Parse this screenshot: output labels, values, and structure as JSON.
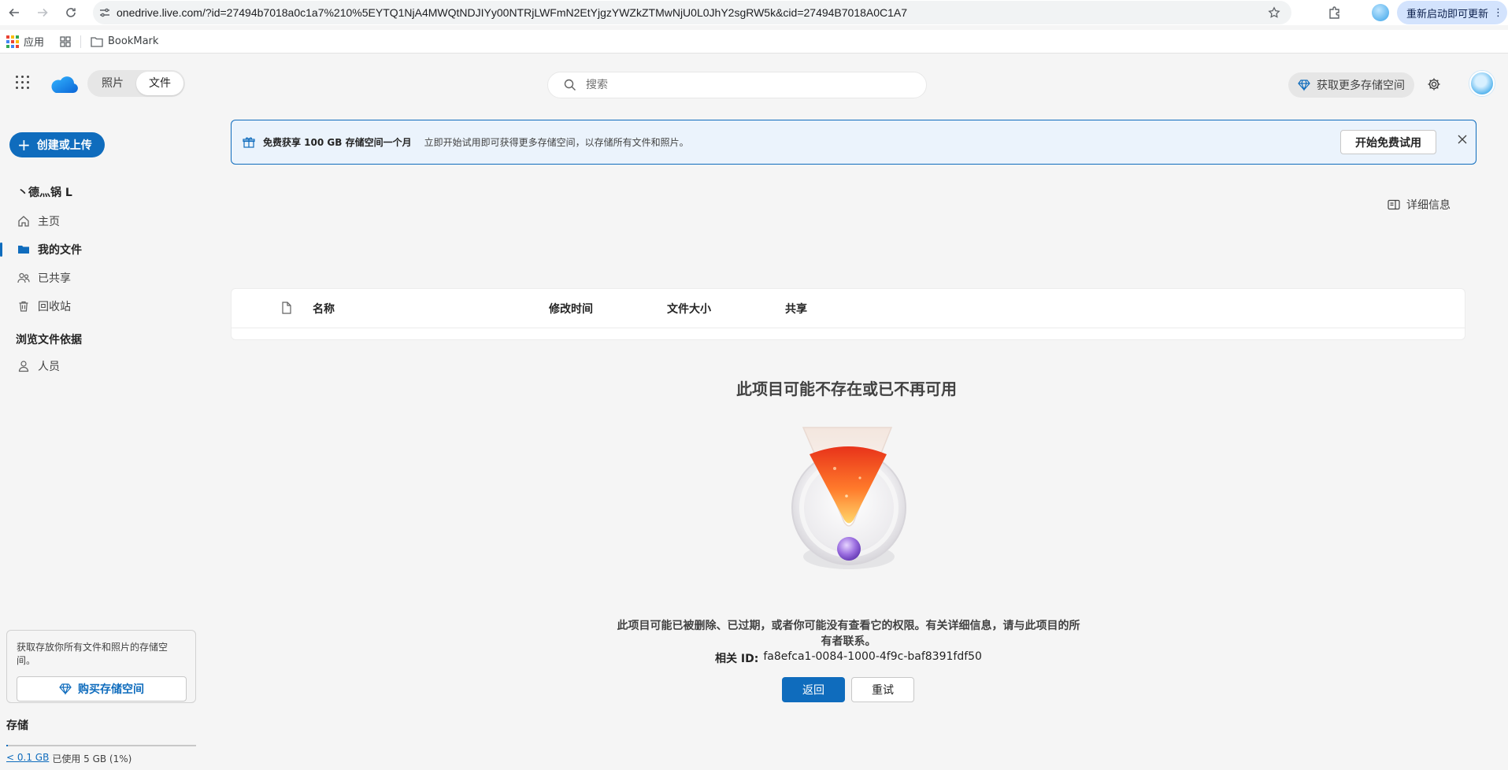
{
  "browser": {
    "url": "onedrive.live.com/?id=27494b7018a0c1a7%210%5EYTQ1NjA4MWQtNDJIYy00NTRjLWFmN2EtYjgzYWZkZTMwNjU0L0JhY2sgRW5k&cid=27494B7018A0C1A7",
    "update_label": "重新启动即可更新",
    "bookmarks": {
      "apps_label": "应用",
      "folder_label": "BookMark"
    }
  },
  "header": {
    "tabs": [
      {
        "label": "照片"
      },
      {
        "label": "文件"
      }
    ],
    "search": {
      "placeholder": "搜索",
      "value": ""
    },
    "get_storage_label": "获取更多存储空间"
  },
  "sidebar": {
    "create_label": "创建或上传",
    "account_name": "丶德灬锅 L",
    "items": [
      {
        "label": "主页",
        "icon": "home-icon"
      },
      {
        "label": "我的文件",
        "icon": "folder-icon"
      },
      {
        "label": "已共享",
        "icon": "people-icon"
      },
      {
        "label": "回收站",
        "icon": "trash-icon"
      }
    ],
    "browse_heading": "浏览文件依据",
    "browse_items": [
      {
        "label": "人员",
        "icon": "person-icon"
      }
    ],
    "promo": {
      "text": "获取存放你所有文件和照片的存储空间。",
      "button_label": "购买存储空间"
    },
    "storage": {
      "heading": "存储",
      "used_link": "< 0.1 GB",
      "used_text": "已使用 5 GB (1%)",
      "used_fraction": 0.01
    }
  },
  "banner": {
    "title": "免费获享 100 GB 存储空间一个月",
    "description": "立即开始试用即可获得更多存储空间，以存储所有文件和照片。",
    "trial_label": "开始免费试用"
  },
  "details_label": "详细信息",
  "table": {
    "columns": [
      "名称",
      "修改时间",
      "文件大小",
      "共享"
    ]
  },
  "error": {
    "title": "此项目可能不存在或已不再可用",
    "description": "此项目可能已被删除、已过期，或者你可能没有查看它的权限。有关详细信息，请与此项目的所有者联系。",
    "id_label": "相关 ID:",
    "id_value": "fa8efca1-0084-1000-4f9c-baf8391fdf50",
    "back_label": "返回",
    "retry_label": "重试"
  },
  "colors": {
    "accent": "#0f6cbd",
    "banner_bg": "#ebf3fc",
    "page_bg": "#f5f5f5"
  }
}
